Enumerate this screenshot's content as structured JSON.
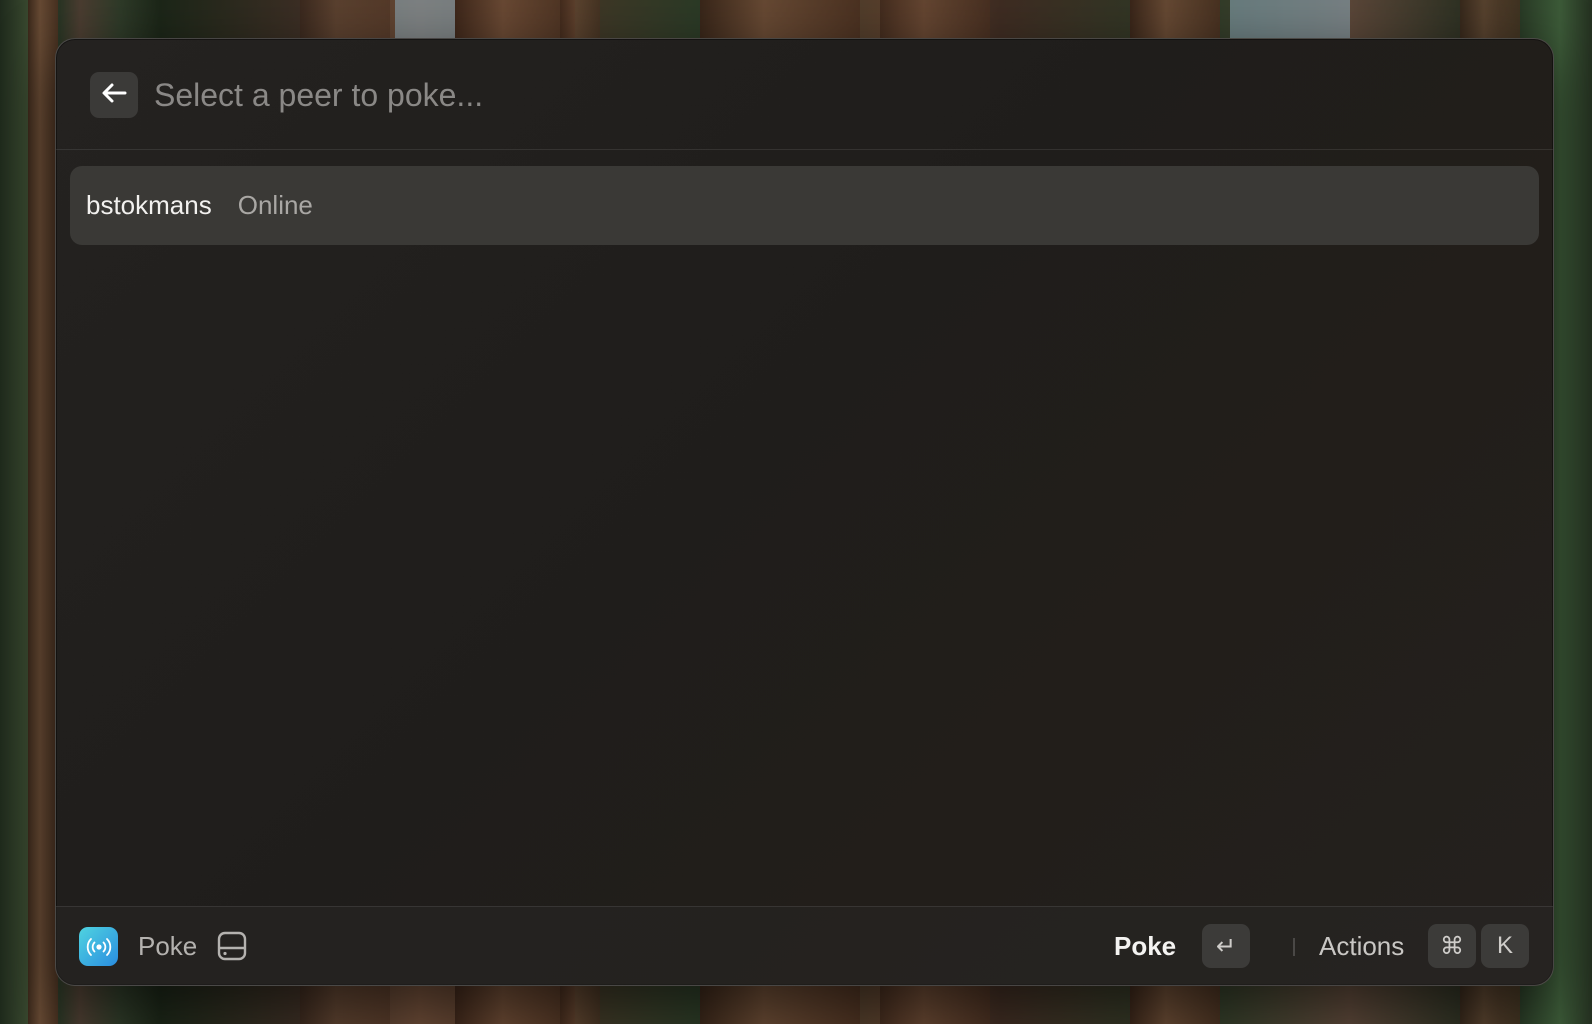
{
  "search": {
    "placeholder": "Select a peer to poke..."
  },
  "peers": [
    {
      "name": "bstokmans",
      "status": "Online"
    }
  ],
  "footer": {
    "app_name": "Poke",
    "app_icon": "broadcast-icon",
    "extension_icon": "drive-icon",
    "primary_action": "Poke",
    "primary_key": "↵",
    "actions_label": "Actions",
    "actions_key_modifier": "⌘",
    "actions_key": "K"
  },
  "colors": {
    "window_bg": "#1f1d1b",
    "selected_row_bg": "#3a3936",
    "app_icon_gradient_start": "#4fd3e0",
    "app_icon_gradient_end": "#2a8de0"
  }
}
